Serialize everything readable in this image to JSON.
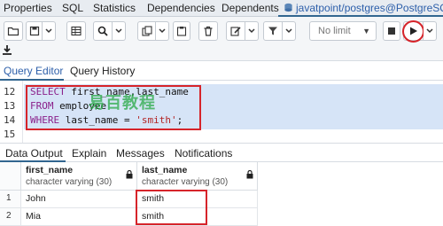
{
  "top_tabs": [
    {
      "label": "Properties"
    },
    {
      "label": "SQL"
    },
    {
      "label": "Statistics"
    },
    {
      "label": "Dependencies"
    },
    {
      "label": "Dependents"
    },
    {
      "label": "javatpoint/postgres@PostgreSQL",
      "icon": "database-connection-icon",
      "active": true
    }
  ],
  "toolbar": {
    "limit_value": "No limit",
    "icons": [
      "folder-open-icon",
      "save-icon",
      "chevron-down-icon",
      "grid-icon",
      "search-icon",
      "chevron-down-icon",
      "copy-icon",
      "paste-icon",
      "delete-icon",
      "edit-icon",
      "chevron-down-icon",
      "filter-icon",
      "chevron-down-icon",
      "stop-icon",
      "execute-icon",
      "chevron-down-icon",
      "download-icon"
    ],
    "accent_color": "#d6242a"
  },
  "editor_tabs": [
    {
      "label": "Query Editor",
      "active": true
    },
    {
      "label": "Query History"
    }
  ],
  "editor": {
    "lines": [
      {
        "num": "12",
        "text": "SELECT first_name,last_name"
      },
      {
        "num": "13",
        "text": "FROM employee"
      },
      {
        "num": "14",
        "text": "WHERE last_name = 'smith';"
      },
      {
        "num": "15",
        "text": ""
      }
    ],
    "watermark": "易百教程"
  },
  "output_tabs": [
    {
      "label": "Data Output",
      "active": true
    },
    {
      "label": "Explain"
    },
    {
      "label": "Messages"
    },
    {
      "label": "Notifications"
    }
  ],
  "grid": {
    "columns": [
      {
        "name": "first_name",
        "type": "character varying (30)"
      },
      {
        "name": "last_name",
        "type": "character varying (30)"
      }
    ],
    "rows": [
      {
        "num": "1",
        "cells": [
          "John",
          "smith"
        ]
      },
      {
        "num": "2",
        "cells": [
          "Mia",
          "smith"
        ]
      }
    ]
  }
}
